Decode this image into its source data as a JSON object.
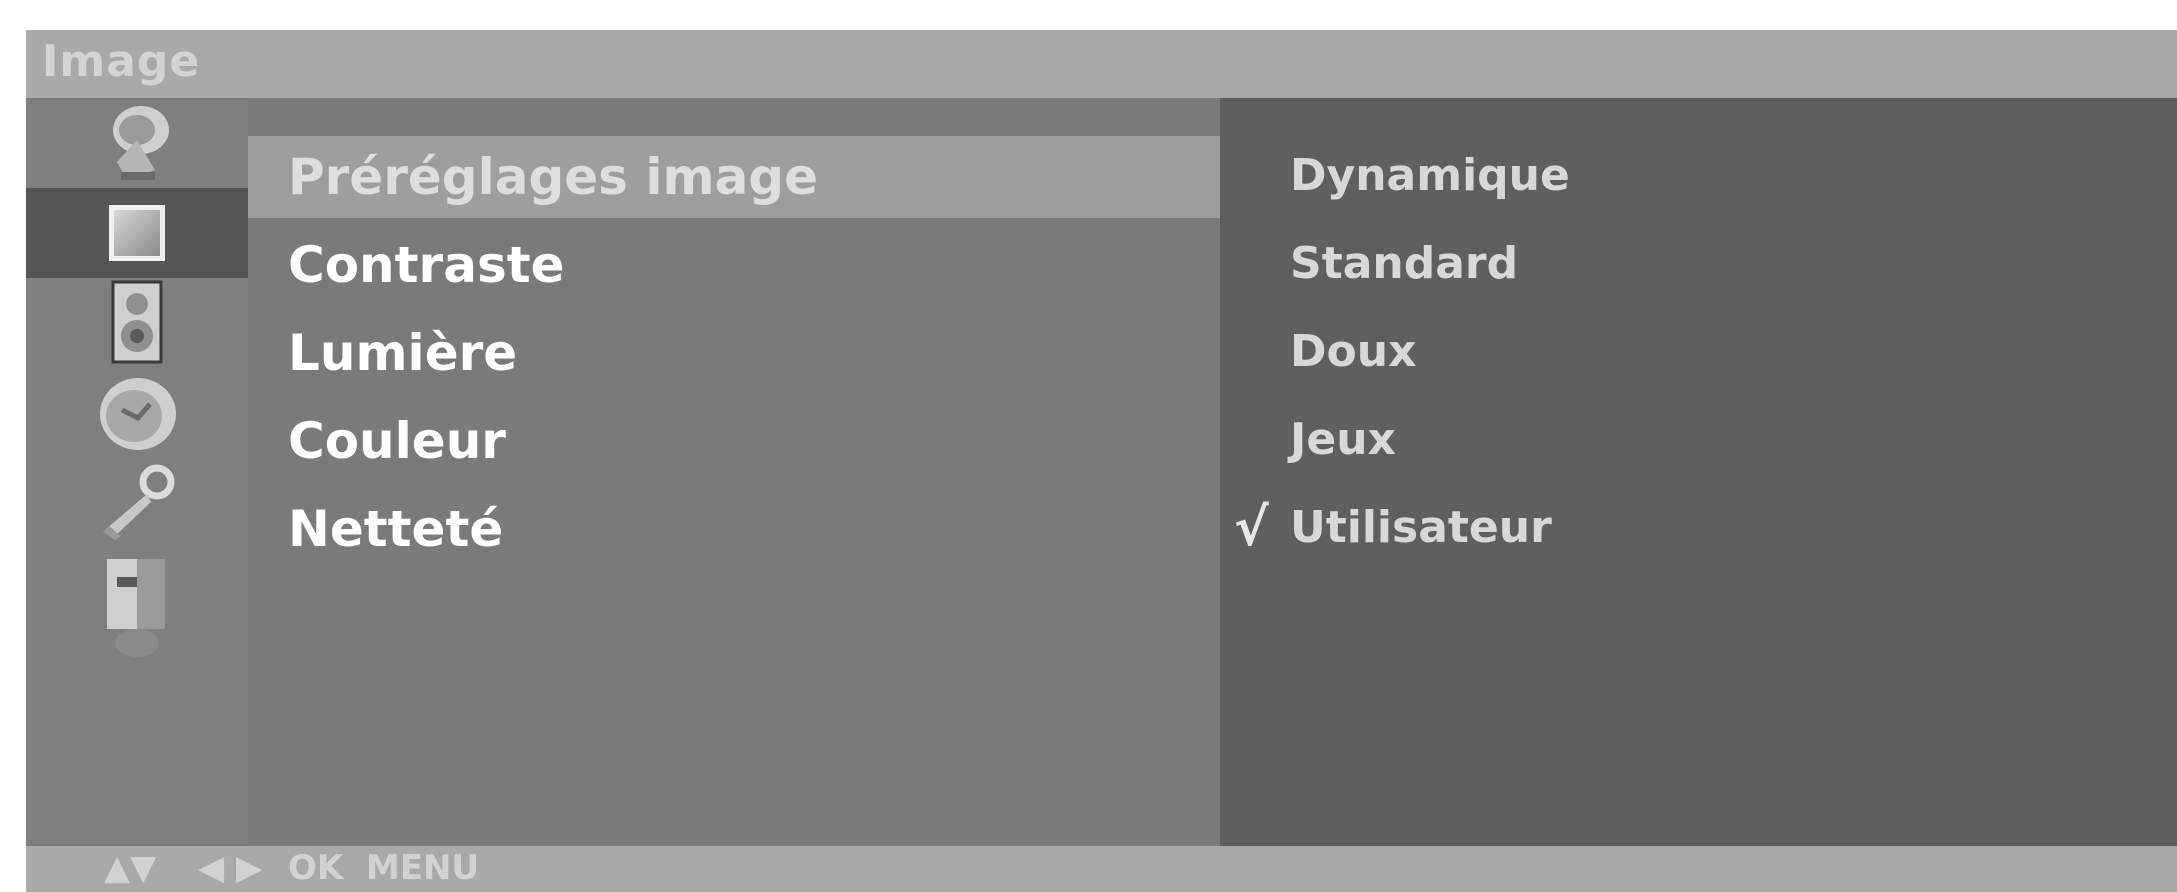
{
  "osd": {
    "title": "Image"
  },
  "icons": [
    {
      "name": "satellite-dish-icon",
      "selected": false
    },
    {
      "name": "picture-square-icon",
      "selected": true
    },
    {
      "name": "speaker-icon",
      "selected": false
    },
    {
      "name": "clock-icon",
      "selected": false
    },
    {
      "name": "key-lock-icon",
      "selected": false
    },
    {
      "name": "input-connector-icon",
      "selected": false
    }
  ],
  "menu": {
    "items": [
      {
        "label": "Préréglages image",
        "highlighted": true
      },
      {
        "label": "Contraste",
        "highlighted": false
      },
      {
        "label": "Lumière",
        "highlighted": false
      },
      {
        "label": "Couleur",
        "highlighted": false
      },
      {
        "label": "Netteté",
        "highlighted": false
      }
    ]
  },
  "submenu": {
    "items": [
      {
        "label": "Dynamique",
        "checked": false
      },
      {
        "label": "Standard",
        "checked": false
      },
      {
        "label": "Doux",
        "checked": false
      },
      {
        "label": "Jeux",
        "checked": false
      },
      {
        "label": "Utilisateur",
        "checked": true
      }
    ],
    "check_mark": "√"
  },
  "hints": {
    "updown": "▲▼",
    "leftright": "◀ ▶",
    "ok": "OK",
    "menu": "MENU"
  }
}
